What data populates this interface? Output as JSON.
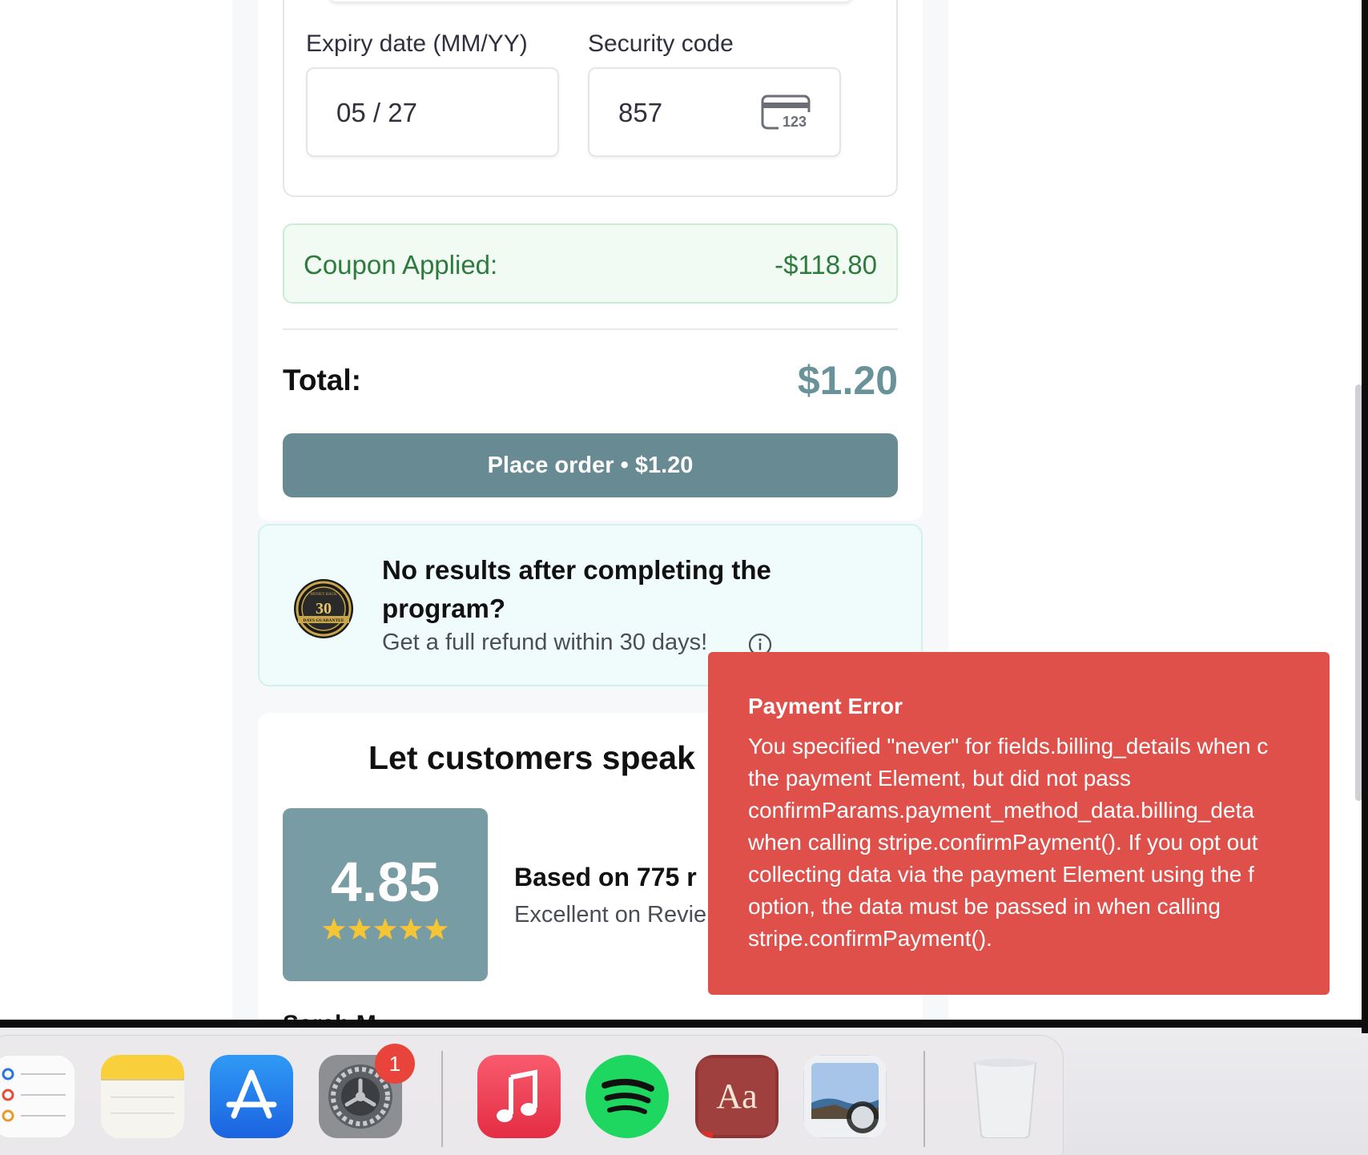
{
  "checkout": {
    "expiry_label": "Expiry date (MM/YY)",
    "expiry_value": "05 / 27",
    "security_label": "Security code",
    "security_value": "857",
    "cvc_icon_text": "123",
    "coupon_label": "Coupon Applied:",
    "coupon_value": "-$118.80",
    "total_label": "Total:",
    "total_value": "$1.20",
    "place_order_label": "Place order • $1.20"
  },
  "guarantee": {
    "badge_number": "30",
    "badge_top_text": "MONEY BACK",
    "badge_bottom_text": "DAYS GUARANTEE",
    "title": "No results after completing the program?",
    "subtitle": "Get a full refund within 30 days!"
  },
  "reviews": {
    "title": "Let customers speak",
    "rating": "4.85",
    "stars": 5,
    "based_on": "Based on 775 r",
    "excellent": "Excellent on Revie",
    "reviewer_partial": "Sarah M."
  },
  "toast": {
    "title": "Payment Error",
    "lines": [
      "You specified \"never\" for fields.billing_details when c",
      "the payment Element, but did not pass",
      "confirmParams.payment_method_data.billing_deta",
      "when calling stripe.confirmPayment(). If you opt out",
      "collecting data via the payment Element using the f",
      "option, the data must be passed in when calling",
      "stripe.confirmPayment()."
    ]
  },
  "dock": {
    "apps": [
      "Reminders",
      "Notes",
      "App Store",
      "System Settings",
      "Music",
      "Spotify",
      "Dictionary",
      "Preview",
      "Trash"
    ],
    "settings_badge": "1",
    "dictionary_text": "Aa"
  },
  "colors": {
    "primary": "#688b93",
    "total": "#6a9399",
    "coupon_text": "#2f7a3d",
    "toast_bg": "#df504b"
  }
}
